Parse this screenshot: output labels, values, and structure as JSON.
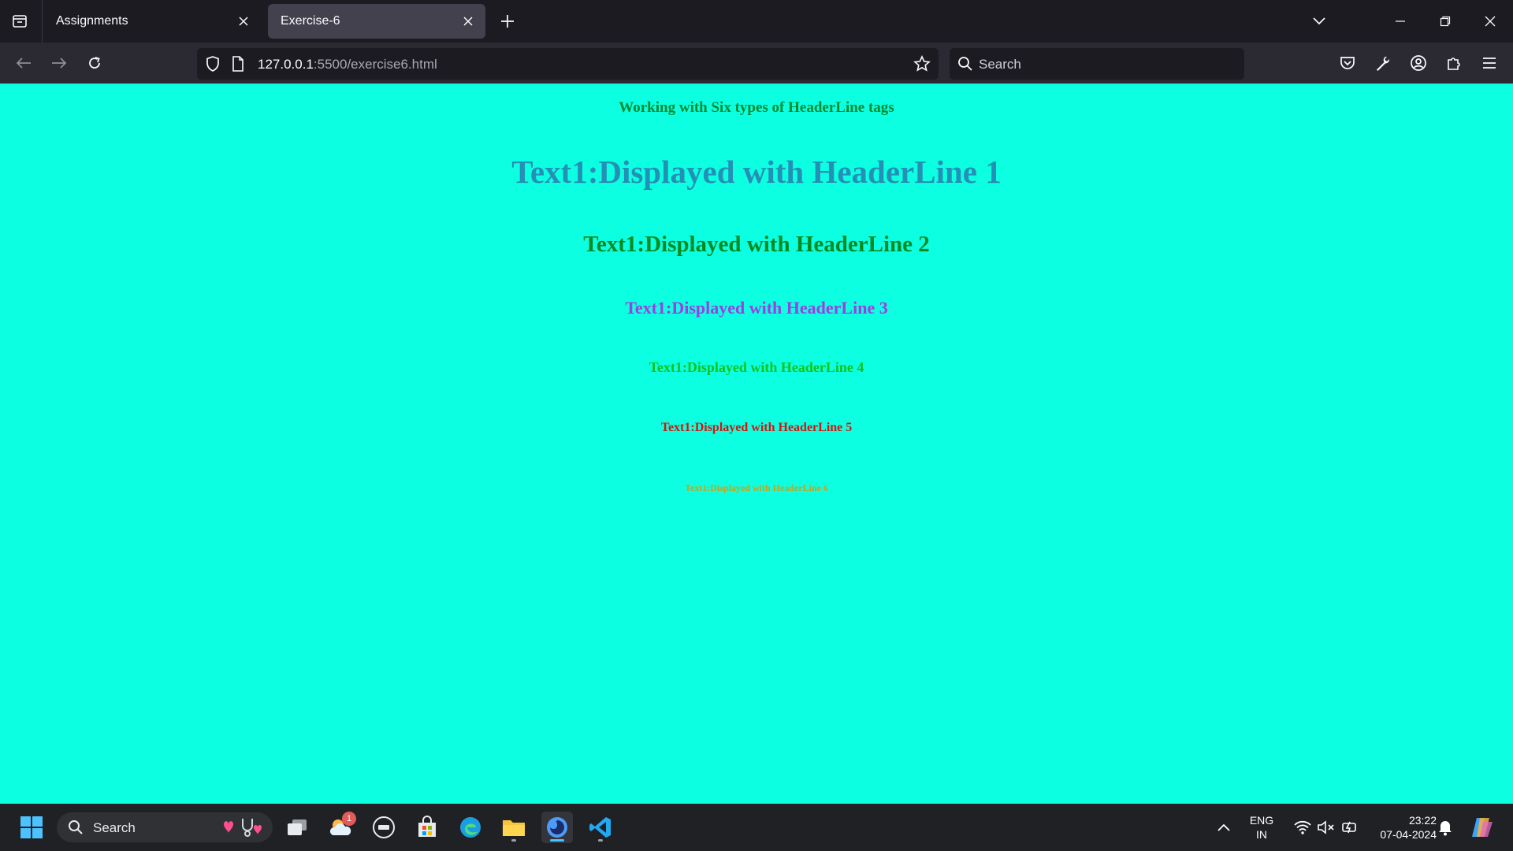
{
  "tabs": [
    {
      "label": "Assignments",
      "active": false
    },
    {
      "label": "Exercise-6",
      "active": true
    }
  ],
  "urlbar": {
    "url_host": "127.0.0.1",
    "url_path": ":5500/exercise6.html"
  },
  "searchbar": {
    "placeholder": "Search"
  },
  "page": {
    "intro": "Working with Six types of HeaderLine tags",
    "h1": "Text1:Displayed with HeaderLine 1",
    "h2": "Text1:Displayed with HeaderLine 2",
    "h3": "Text1:Displayed with HeaderLine 3",
    "h4": "Text1:Displayed with HeaderLine 4",
    "h5": "Text1:Displayed with HeaderLine 5",
    "h6": "Text1:Displayed with HeaderLine 6",
    "background_color": "#0cffe1"
  },
  "taskbar": {
    "search_label": "Search",
    "weather_badge": "1",
    "language": "ENG",
    "region": "IN",
    "time": "23:22",
    "date": "07-04-2024"
  }
}
